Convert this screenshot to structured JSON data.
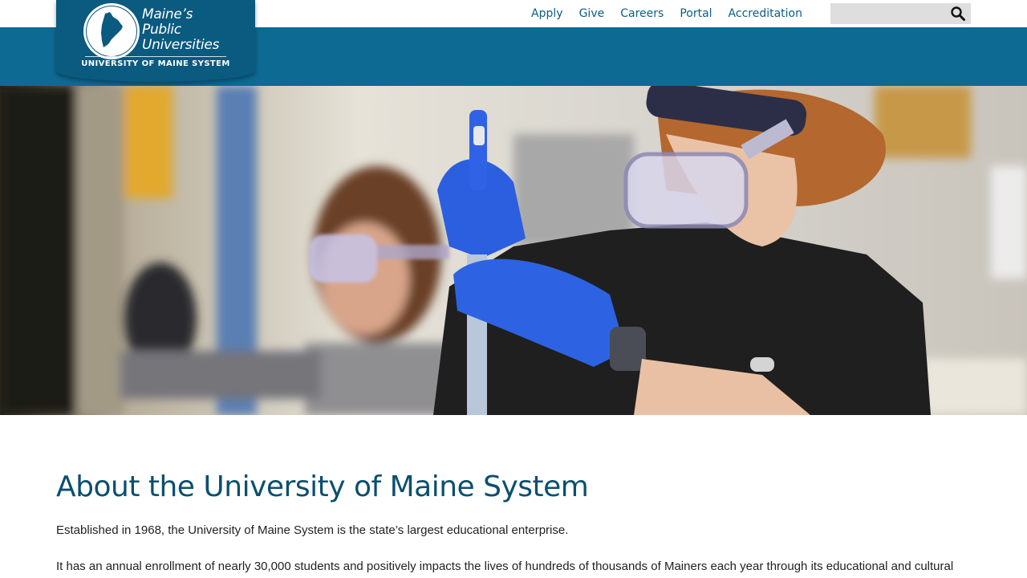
{
  "logo": {
    "line1": "Maine’s",
    "line2": "Public",
    "line3": "Universities",
    "subtitle": "UNIVERSITY OF MAINE SYSTEM"
  },
  "utility_nav": {
    "items": [
      {
        "label": "Apply"
      },
      {
        "label": "Give"
      },
      {
        "label": "Careers"
      },
      {
        "label": "Portal"
      },
      {
        "label": "Accreditation"
      }
    ]
  },
  "search": {
    "value": "",
    "icon": "search-icon"
  },
  "colors": {
    "brand_blue": "#0d6a93",
    "logo_blue": "#0b5a7f",
    "link_blue": "#0b5e84",
    "title_blue": "#0b4f6e"
  },
  "content": {
    "title": "About the University of Maine System",
    "paragraph1": "Established in 1968, the University of Maine System is the state’s largest educational enterprise.",
    "paragraph2": "It has an annual enrollment of nearly 30,000 students and positively impacts the lives of hundreds of thousands of Mainers each year through its educational and cultural"
  }
}
